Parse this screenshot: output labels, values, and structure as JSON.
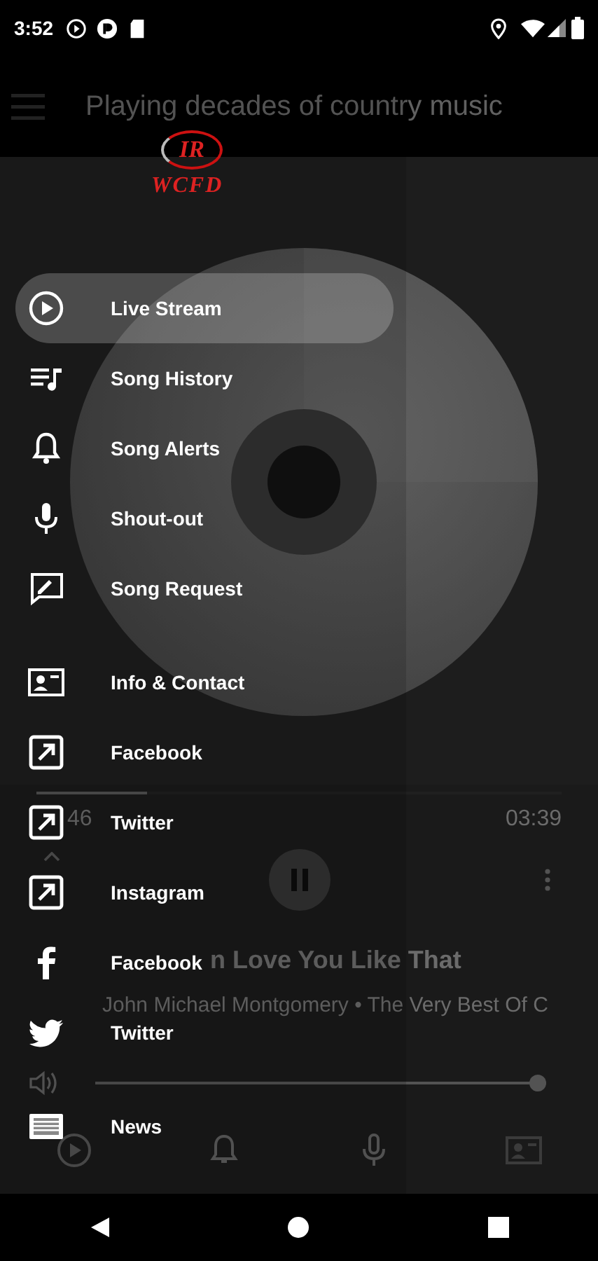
{
  "status_bar": {
    "time": "3:52"
  },
  "app_bar": {
    "title": "Playing decades of country music"
  },
  "player": {
    "seek": {
      "level": 0.21
    },
    "elapsed": "46",
    "duration": "03:39",
    "playing": true,
    "title": "n Love You Like That",
    "artist": "John Michael Montgomery • The Very Best Of C",
    "volume": {
      "level": 0.99
    }
  },
  "drawer": {
    "logo": {
      "mark": "IR",
      "name": "WCFD"
    },
    "sections": [
      [
        {
          "label": "Live Stream",
          "selected": true
        },
        {
          "label": "Song History",
          "selected": false
        },
        {
          "label": "Song Alerts",
          "selected": false
        },
        {
          "label": "Shout-out",
          "selected": false
        },
        {
          "label": "Song Request",
          "selected": false
        }
      ],
      [
        {
          "label": "Info & Contact",
          "selected": false
        },
        {
          "label": "Facebook",
          "selected": false
        },
        {
          "label": "Twitter",
          "selected": false
        },
        {
          "label": "Instagram",
          "selected": false
        },
        {
          "label": "Facebook",
          "selected": false
        },
        {
          "label": "Twitter",
          "selected": false
        }
      ],
      [
        {
          "label": "News",
          "selected": false
        }
      ]
    ]
  }
}
